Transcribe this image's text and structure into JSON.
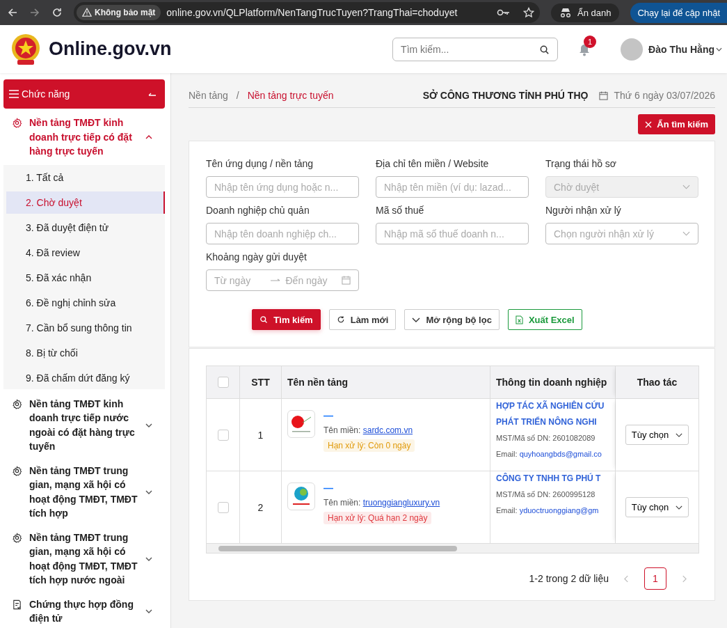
{
  "browser": {
    "security": "Không bảo mật",
    "url": "online.gov.vn/QLPlatform/NenTangTrucTuyen?TrangThai=choduyet",
    "incognito": "Ẩn danh",
    "update": "Chạy lại để cập nhật"
  },
  "header": {
    "logo": "Online.gov.vn",
    "search": {
      "placeholder": "Tìm kiếm..."
    },
    "notifications": "1",
    "user": "Đào Thu Hằng"
  },
  "sidebar": {
    "title": "Chức năng",
    "groups": [
      {
        "label": "Nền tảng TMĐT kinh doanh trực tiếp có đặt hàng trực tuyến",
        "kind": "gear",
        "expanded": true,
        "children": [
          {
            "label": "1. Tất cả",
            "selected": false
          },
          {
            "label": "2. Chờ duyệt",
            "selected": true
          },
          {
            "label": "3. Đã duyệt điện tử",
            "selected": false
          },
          {
            "label": "4. Đã review",
            "selected": false
          },
          {
            "label": "5. Đã xác nhận",
            "selected": false
          },
          {
            "label": "6. Đề nghị chỉnh sửa",
            "selected": false
          },
          {
            "label": "7. Cần bổ sung thông tin",
            "selected": false
          },
          {
            "label": "8. Bị từ chối",
            "selected": false
          },
          {
            "label": "9. Đã chấm dứt đăng ký",
            "selected": false
          }
        ]
      },
      {
        "label": "Nền tảng TMĐT kinh doanh trực tiếp nước ngoài có đặt hàng trực tuyến",
        "kind": "gear",
        "expanded": false
      },
      {
        "label": "Nền tảng TMĐT trung gian, mạng xã hội có hoạt động TMĐT, TMĐT tích hợp",
        "kind": "gear",
        "expanded": false
      },
      {
        "label": "Nền tảng TMĐT trung gian, mạng xã hội có hoạt động TMĐT, TMĐT tích hợp nước ngoài",
        "kind": "gear",
        "expanded": false
      },
      {
        "label": "Chứng thực hợp đồng điện tử",
        "kind": "document",
        "expanded": false
      }
    ]
  },
  "breadcrumb": [
    "Nền tảng",
    "Nền tảng trực tuyến"
  ],
  "breadcrumb_separator": "/",
  "agency": "SỞ CÔNG THƯƠNG TỈNH PHÚ THỌ",
  "date": "Thứ 6 ngày 03/07/2026",
  "hide_search": "Ẩn tìm kiếm",
  "filters": [
    {
      "label": "Tên ứng dụng / nền tảng",
      "kind": "text",
      "placeholder": "Nhập tên ứng dụng hoặc n..."
    },
    {
      "label": "Địa chỉ tên miền / Website",
      "kind": "text",
      "placeholder": "Nhập tên miền (ví dụ: lazad..."
    },
    {
      "label": "Trạng thái hồ sơ",
      "kind": "select",
      "value": "Chờ duyệt",
      "disabled": true
    },
    {
      "label": "Doanh nghiệp chủ quản",
      "kind": "text",
      "placeholder": "Nhập tên doanh nghiệp ch..."
    },
    {
      "label": "Mã số thuế",
      "kind": "text",
      "placeholder": "Nhập mã số thuế doanh n..."
    },
    {
      "label": "Người nhận xử lý",
      "kind": "select",
      "placeholder": "Chọn người nhận xử lý",
      "disabled": false
    },
    {
      "label": "Khoảng ngày gửi duyệt",
      "kind": "daterange",
      "from": "Từ ngày",
      "to": "Đến ngày"
    }
  ],
  "actions": [
    {
      "label": "Tìm kiếm",
      "kind": "primary"
    },
    {
      "label": "Làm mới",
      "kind": "reset"
    },
    {
      "label": "Mở rộng bộ lọc",
      "kind": "expand"
    },
    {
      "label": "Xuất Excel",
      "kind": "excel"
    }
  ],
  "table": {
    "all_checked": false,
    "columns": [
      "STT",
      "Tên nền tảng",
      "Thông tin doanh nghiệp",
      "Thao tác"
    ],
    "rows": [
      {
        "index": "1",
        "checked": false,
        "logo": {
          "kind": "picture"
        },
        "name": "—",
        "domain_label": "Tên miền:",
        "domain": "sardc.com.vn",
        "deadline": "Hạn xử lý: Còn 0 ngày",
        "color": "#e09a0a",
        "company": [
          "HỢP TÁC XÃ NGHIÊN CỨU",
          "PHÁT TRIỂN NÔNG NGHI"
        ],
        "tax": "MST/Mã số DN: 2601082089",
        "email_label": "Email:",
        "email": "quyhoangbds@gmail.co",
        "action": "Tùy chọn"
      },
      {
        "index": "2",
        "checked": false,
        "logo": {
          "kind": "picture"
        },
        "name": "—",
        "domain_label": "Tên miền:",
        "domain": "truonggiangluxury.vn",
        "deadline": "Hạn xử lý: Quá hạn 2 ngày",
        "color": "#e0383e",
        "company": [
          "CÔNG TY TNHH TG PHÚ T"
        ],
        "tax": "MST/Mã số DN: 2600995128",
        "email_label": "Email:",
        "email": "yduoctruonggiang@gm",
        "action": "Tùy chọn"
      }
    ]
  },
  "pagination": {
    "summary": "1-2 trong 2 dữ liệu",
    "pages": [
      {
        "label": "1",
        "selected": true
      }
    ]
  }
}
